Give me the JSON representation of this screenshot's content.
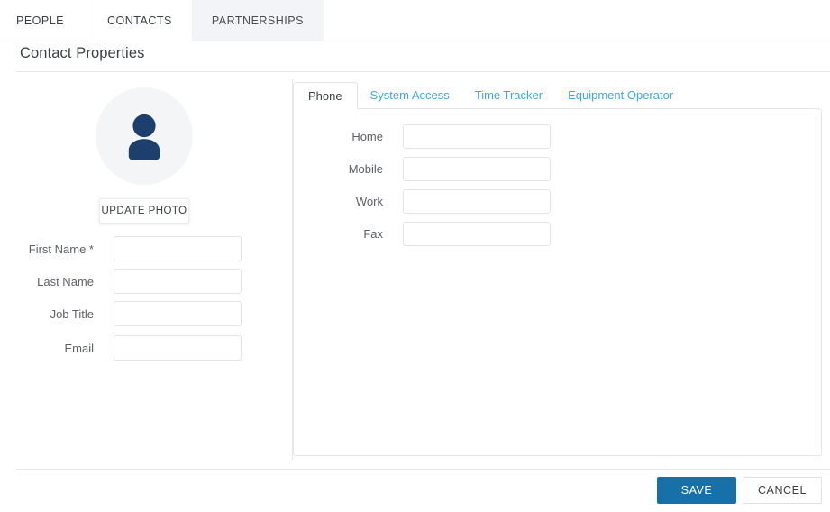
{
  "top_nav": {
    "tabs": [
      {
        "label": "PEOPLE",
        "state": "plain"
      },
      {
        "label": "CONTACTS",
        "state": "active"
      },
      {
        "label": "PARTNERSHIPS",
        "state": "muted"
      }
    ]
  },
  "header": {
    "title": "Contact Properties"
  },
  "profile": {
    "avatar_icon": "user-avatar-icon",
    "update_photo_label": "UPDATE PHOTO",
    "fields": [
      {
        "label": "First Name *",
        "value": "",
        "placeholder": ""
      },
      {
        "label": "Last Name",
        "value": "",
        "placeholder": ""
      },
      {
        "label": "Job Title",
        "value": "",
        "placeholder": ""
      },
      {
        "label": "Email",
        "value": "",
        "placeholder": ""
      }
    ]
  },
  "detail_tabs": {
    "items": [
      {
        "label": "Phone",
        "state": "active"
      },
      {
        "label": "System Access",
        "state": "link"
      },
      {
        "label": "Time Tracker",
        "state": "link"
      },
      {
        "label": "Equipment Operator",
        "state": "link"
      }
    ]
  },
  "phone_panel": {
    "fields": [
      {
        "label": "Home",
        "value": "",
        "placeholder": ""
      },
      {
        "label": "Mobile",
        "value": "",
        "placeholder": ""
      },
      {
        "label": "Work",
        "value": "",
        "placeholder": ""
      },
      {
        "label": "Fax",
        "value": "",
        "placeholder": ""
      }
    ]
  },
  "footer": {
    "save_label": "SAVE",
    "cancel_label": "CANCEL"
  },
  "colors": {
    "accent_blue": "#1870a8",
    "link_blue": "#3fa9dc",
    "avatar_navy": "#1c3f6e",
    "avatar_bg": "#f4f5f7",
    "border_gray": "#e4e5e9",
    "tab_muted_bg": "#f3f4f7",
    "text_primary": "#3c4043",
    "text_label": "#5e6165"
  }
}
